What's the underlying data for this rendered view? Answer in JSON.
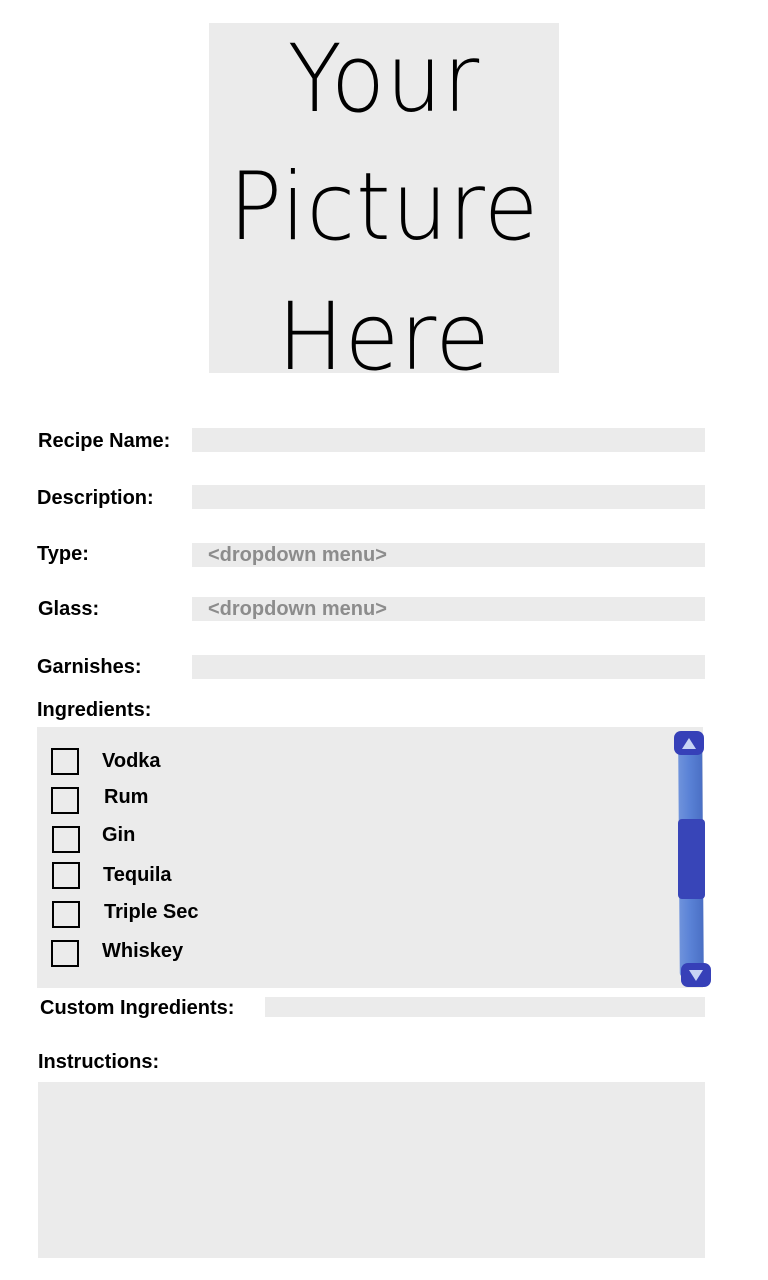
{
  "picture": {
    "line1": "Your",
    "line2": "Picture",
    "line3": "Here"
  },
  "form": {
    "recipe_name_label": "Recipe Name:",
    "recipe_name_value": "",
    "description_label": "Description:",
    "description_value": "",
    "type_label": "Type:",
    "type_placeholder": "<dropdown menu>",
    "glass_label": "Glass:",
    "glass_placeholder": "<dropdown menu>",
    "garnishes_label": "Garnishes:",
    "garnishes_value": "",
    "ingredients_label": "Ingredients:",
    "custom_ingredients_label": "Custom Ingredients:",
    "custom_ingredients_value": "",
    "instructions_label": "Instructions:",
    "instructions_value": ""
  },
  "ingredients": [
    {
      "label": "Vodka",
      "checked": false
    },
    {
      "label": "Rum",
      "checked": false
    },
    {
      "label": "Gin",
      "checked": false
    },
    {
      "label": "Tequila",
      "checked": false
    },
    {
      "label": "Triple Sec",
      "checked": false
    },
    {
      "label": "Whiskey",
      "checked": false
    }
  ],
  "colors": {
    "field_background": "#ebebeb",
    "placeholder_text": "#8c8c8c",
    "scrollbar_track": "#5a82d6",
    "scrollbar_thumb": "#3845b8"
  },
  "icons": {
    "scroll_up": "triangle-up",
    "scroll_down": "triangle-down"
  }
}
